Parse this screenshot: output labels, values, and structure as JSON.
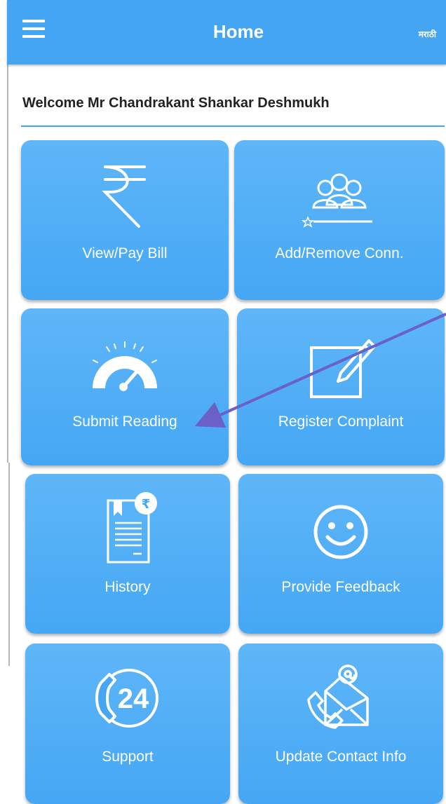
{
  "header": {
    "title": "Home",
    "language_label": "मराठी",
    "menu_icon": "hamburger-menu-icon"
  },
  "welcome": {
    "text": "Welcome Mr Chandrakant Shankar Deshmukh"
  },
  "tiles": [
    {
      "label": "View/Pay Bill",
      "icon": "rupee-icon"
    },
    {
      "label": "Add/Remove Conn.",
      "icon": "users-group-icon"
    },
    {
      "label": "Submit Reading",
      "icon": "speedometer-icon"
    },
    {
      "label": "Register Complaint",
      "icon": "edit-square-icon"
    },
    {
      "label": "History",
      "icon": "bill-history-icon"
    },
    {
      "label": "Provide Feedback",
      "icon": "smiley-icon"
    },
    {
      "label": "Support",
      "icon": "phone-24-icon"
    },
    {
      "label": "Update Contact Info",
      "icon": "email-phone-icon"
    }
  ],
  "colors": {
    "header": "#44a5f3",
    "tile": "#4aa9f5",
    "arrow": "#6a60c8"
  }
}
